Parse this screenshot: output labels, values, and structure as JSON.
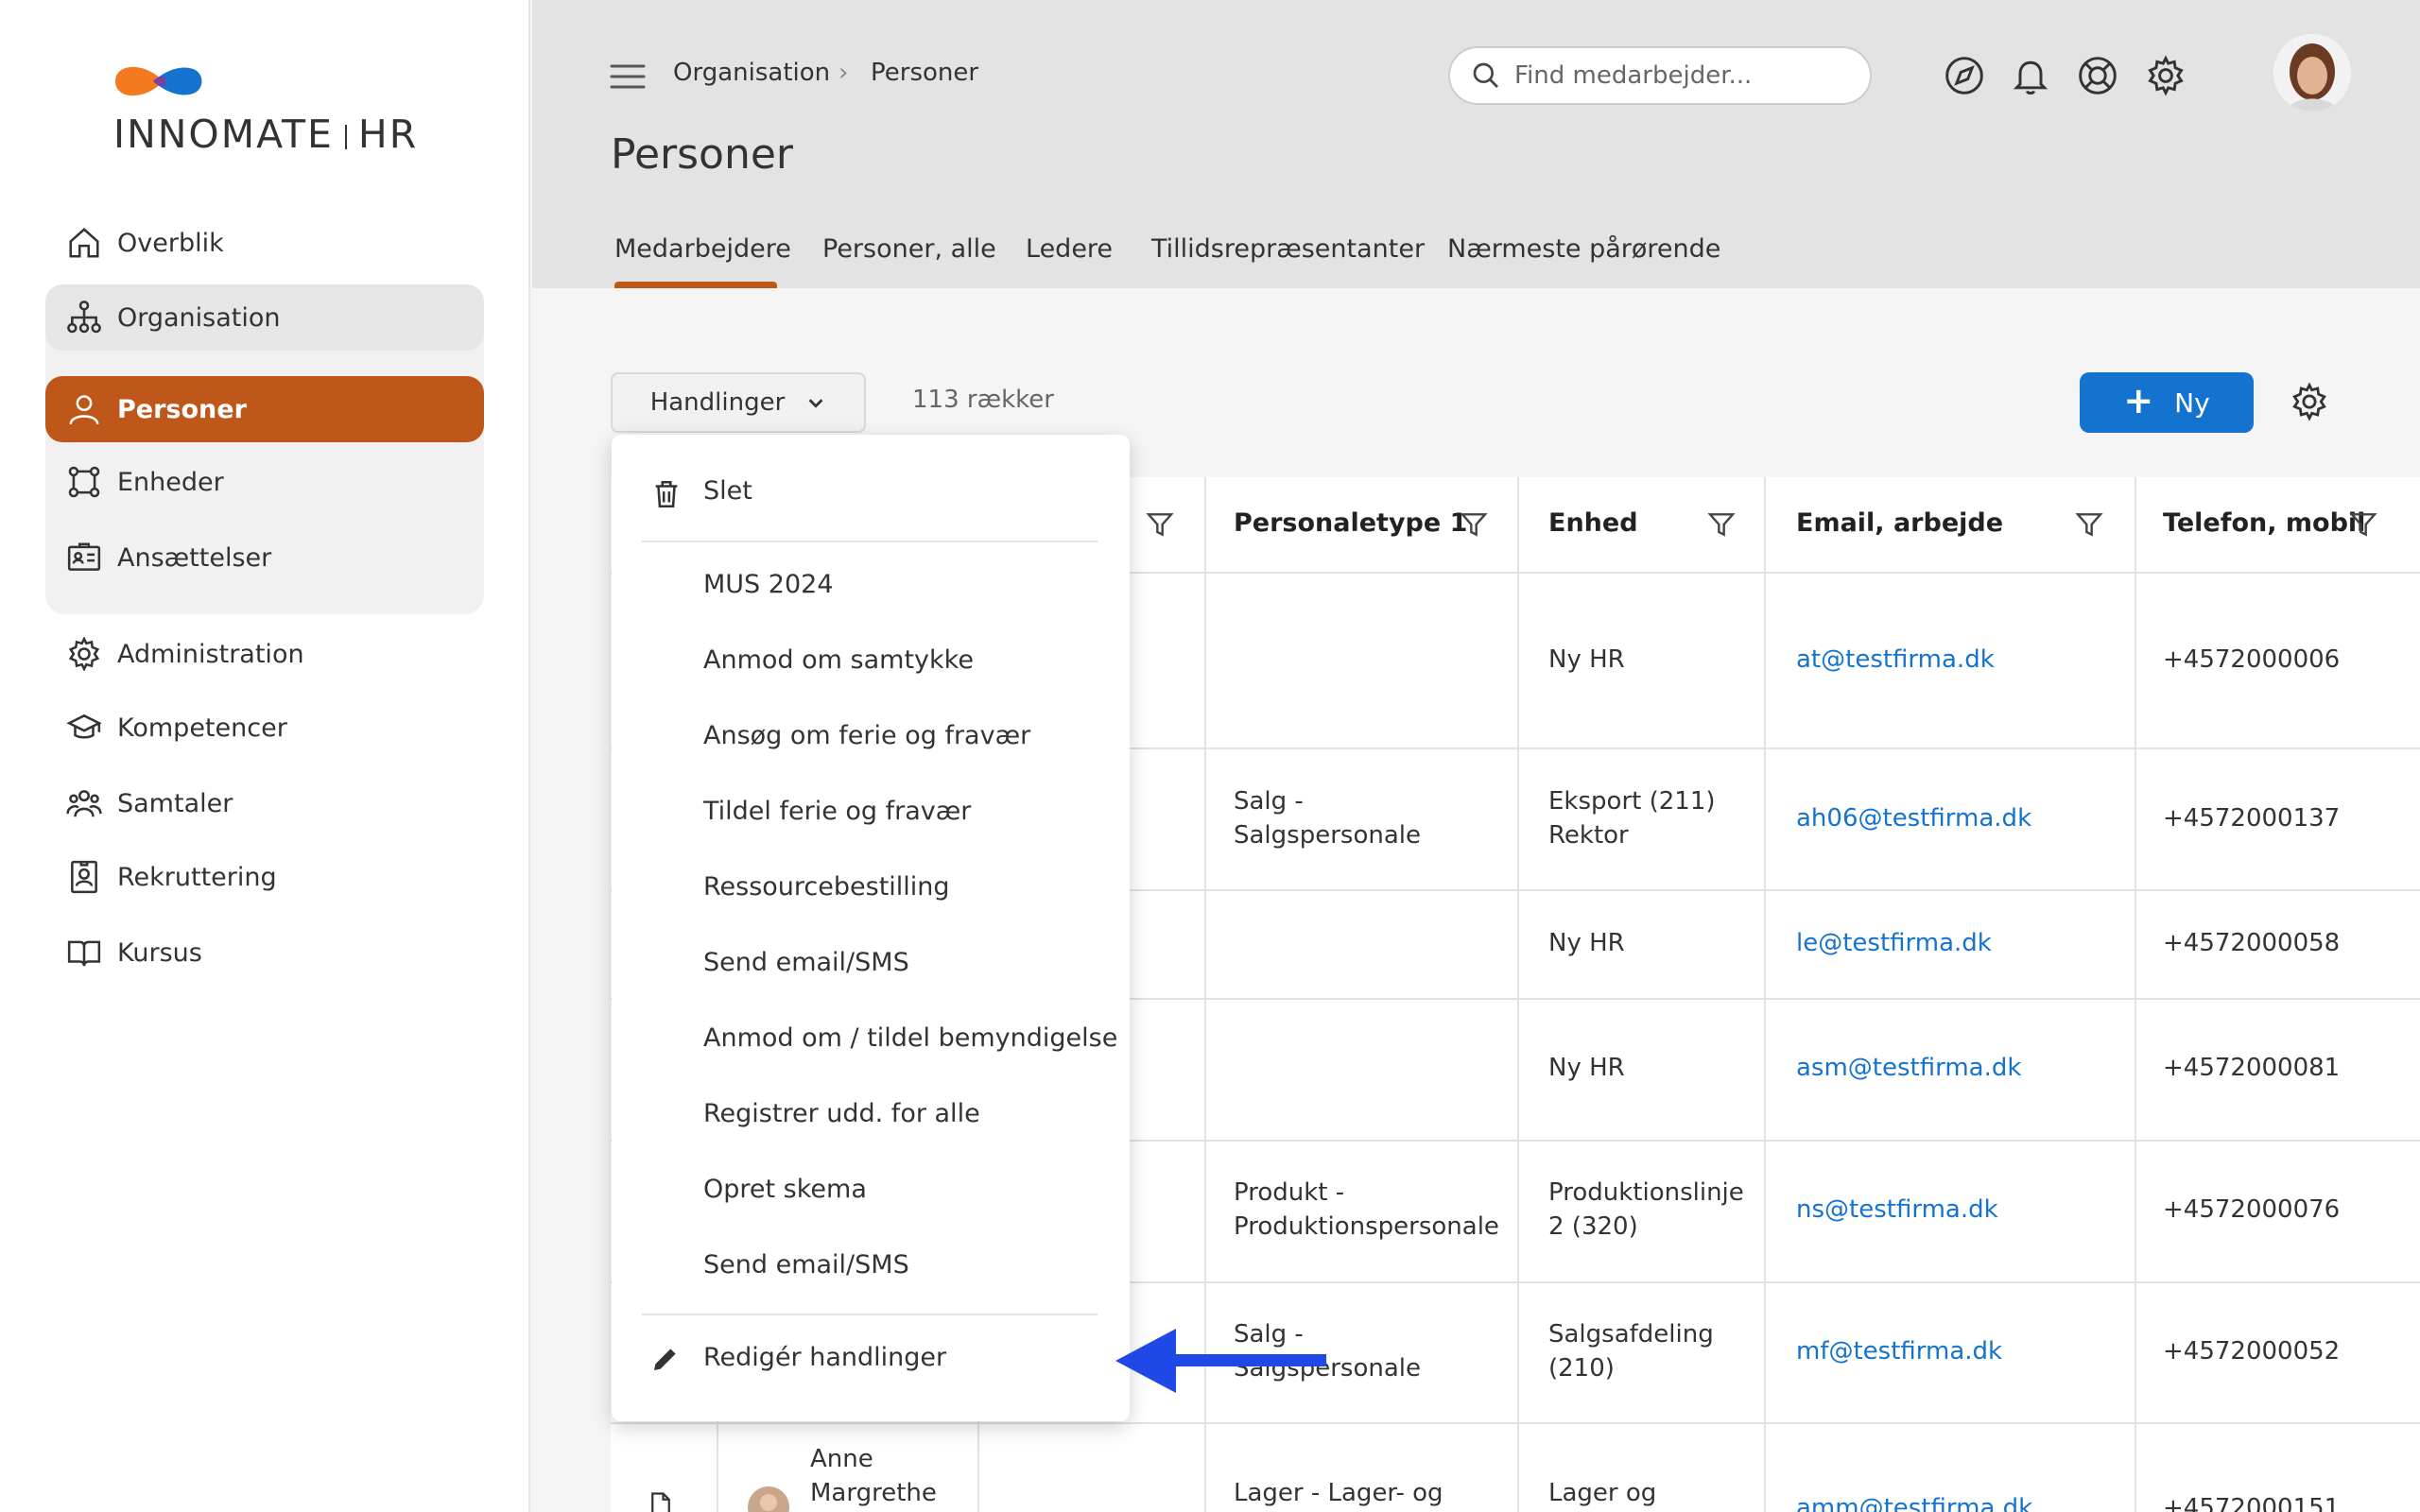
{
  "brand": {
    "name_left": "INNOMATE",
    "name_right": "HR",
    "colors": {
      "orange": "#f47a20",
      "blue": "#1473cf"
    }
  },
  "sidebar": {
    "items": [
      {
        "label": "Overblik",
        "icon": "home-icon"
      },
      {
        "label": "Organisation",
        "icon": "org-chart-icon"
      },
      {
        "label": "Personer",
        "icon": "person-icon",
        "active": true
      },
      {
        "label": "Enheder",
        "icon": "units-icon"
      },
      {
        "label": "Ansættelser",
        "icon": "id-card-icon"
      },
      {
        "label": "Administration",
        "icon": "gear-icon"
      },
      {
        "label": "Kompetencer",
        "icon": "graduation-cap-icon"
      },
      {
        "label": "Samtaler",
        "icon": "people-group-icon"
      },
      {
        "label": "Rekruttering",
        "icon": "badge-icon"
      },
      {
        "label": "Kursus",
        "icon": "book-icon"
      }
    ]
  },
  "header": {
    "breadcrumb": [
      "Organisation",
      "Personer"
    ],
    "title": "Personer",
    "tabs": [
      "Medarbejdere",
      "Personer, alle",
      "Ledere",
      "Tillidsrepræsentanter",
      "Nærmeste pårørende"
    ],
    "active_tab": "Medarbejdere",
    "search_placeholder": "Find medarbejder..."
  },
  "toolbar": {
    "actions_label": "Handlinger",
    "row_count": "113 rækker",
    "new_label": "Ny"
  },
  "menu": {
    "delete": "Slet",
    "items": [
      "MUS 2024",
      "Anmod om samtykke",
      "Ansøg om ferie og fravær",
      "Tildel ferie og fravær",
      "Ressourcebestilling",
      "Send email/SMS",
      "Anmod om / tildel bemyndigelse",
      "Registrer udd. for alle",
      "Opret skema",
      "Send email/SMS"
    ],
    "edit": "Redigér handlinger"
  },
  "table": {
    "columns": [
      "Personaletype 1",
      "Enhed",
      "Email, arbejde",
      "Telefon, mobil"
    ],
    "rows": [
      {
        "type1": "",
        "type2": "",
        "unit1": "Ny HR",
        "unit2": "",
        "email": "at@testfirma.dk",
        "phone": "+4572000006"
      },
      {
        "type1": "Salg -",
        "type2": "Salgspersonale",
        "unit1": "Eksport (211)",
        "unit2": "Rektor",
        "email": "ah06@testfirma.dk",
        "phone": "+4572000137"
      },
      {
        "type1": "",
        "type2": "",
        "unit1": "Ny HR",
        "unit2": "",
        "email": "le@testfirma.dk",
        "phone": "+4572000058"
      },
      {
        "type1": "",
        "type2": "",
        "unit1": "Ny HR",
        "unit2": "",
        "email": "asm@testfirma.dk",
        "phone": "+4572000081"
      },
      {
        "type1": "Produkt -",
        "type2": "Produktionspersonale",
        "unit1": "Produktionslinje",
        "unit2": "2 (320)",
        "email": "ns@testfirma.dk",
        "phone": "+4572000076"
      },
      {
        "type1": "Salg -",
        "type2": "Salgspersonale",
        "unit1": "Salgsafdeling",
        "unit2": "(210)",
        "email": "mf@testfirma.dk",
        "phone": "+4572000052"
      },
      {
        "type1": "Lager - Lager- og",
        "type2": "",
        "unit1": "Lager og",
        "unit2": "",
        "email": "amm@testfirma.dk",
        "phone": "+4572000151",
        "name1": "Anne",
        "name2": "Margrethe"
      }
    ]
  }
}
